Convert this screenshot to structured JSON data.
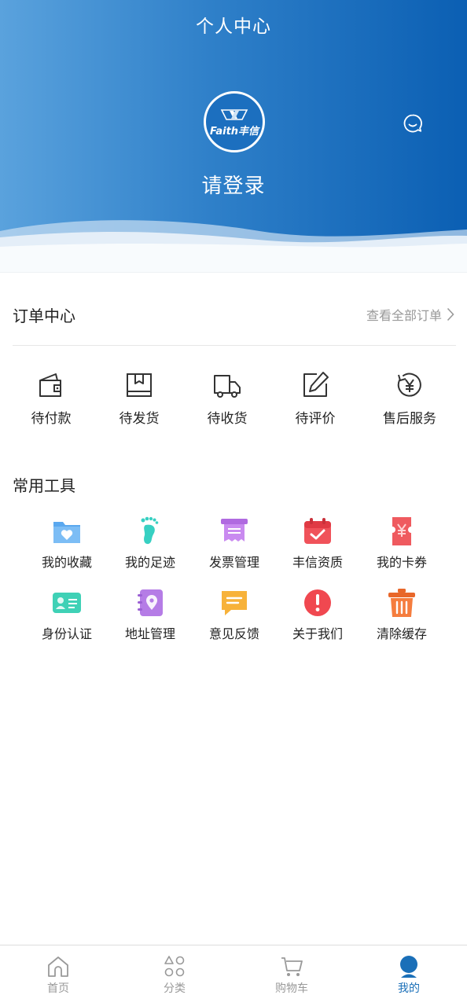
{
  "header": {
    "title": "个人中心",
    "logo_text": "Faith丰信",
    "login_text": "请登录"
  },
  "orders": {
    "title": "订单中心",
    "view_all": "查看全部订单",
    "items": [
      {
        "label": "待付款",
        "icon": "wallet-icon"
      },
      {
        "label": "待发货",
        "icon": "package-icon"
      },
      {
        "label": "待收货",
        "icon": "truck-icon"
      },
      {
        "label": "待评价",
        "icon": "edit-icon"
      },
      {
        "label": "售后服务",
        "icon": "refund-yen-icon"
      }
    ]
  },
  "tools": {
    "title": "常用工具",
    "items": [
      {
        "label": "我的收藏",
        "icon": "folder-heart-icon",
        "color": "#5aa8ef"
      },
      {
        "label": "我的足迹",
        "icon": "footprint-icon",
        "color": "#37d0c2"
      },
      {
        "label": "发票管理",
        "icon": "invoice-icon",
        "color": "#c07be8"
      },
      {
        "label": "丰信资质",
        "icon": "calendar-check-icon",
        "color": "#f0525a"
      },
      {
        "label": "我的卡券",
        "icon": "coupon-icon",
        "color": "#ef5a5f"
      },
      {
        "label": "身份认证",
        "icon": "id-card-icon",
        "color": "#3fd1b6"
      },
      {
        "label": "地址管理",
        "icon": "address-book-icon",
        "color": "#b57ce6"
      },
      {
        "label": "意见反馈",
        "icon": "feedback-icon",
        "color": "#f7b23a"
      },
      {
        "label": "关于我们",
        "icon": "alert-icon",
        "color": "#f04850"
      },
      {
        "label": "清除缓存",
        "icon": "trash-icon",
        "color": "#f57d3e"
      }
    ]
  },
  "tabbar": {
    "items": [
      {
        "label": "首页",
        "icon": "home-icon",
        "active": false
      },
      {
        "label": "分类",
        "icon": "category-icon",
        "active": false
      },
      {
        "label": "购物车",
        "icon": "cart-icon",
        "active": false
      },
      {
        "label": "我的",
        "icon": "user-icon",
        "active": true
      }
    ]
  }
}
